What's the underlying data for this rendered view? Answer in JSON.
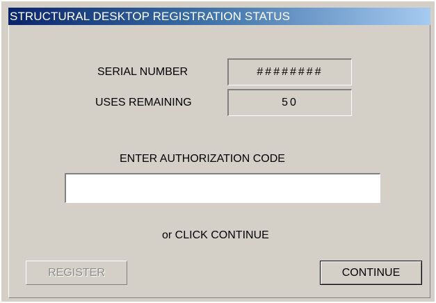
{
  "window": {
    "title": "STRUCTURAL DESKTOP REGISTRATION STATUS"
  },
  "status": {
    "serial_label": "SERIAL NUMBER",
    "serial_value": "########",
    "uses_label": "USES REMAINING",
    "uses_value": "50"
  },
  "authorization": {
    "prompt": "ENTER AUTHORIZATION CODE",
    "value": "",
    "placeholder": ""
  },
  "hint": "or CLICK CONTINUE",
  "buttons": {
    "register_label": "REGISTER",
    "register_enabled": false,
    "continue_label": "CONTINUE"
  }
}
